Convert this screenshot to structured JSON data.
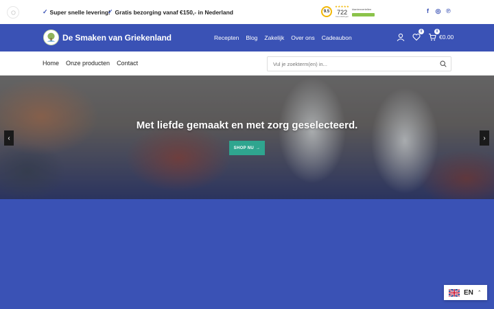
{
  "topbar": {
    "usps": [
      "Super snelle levering!",
      "Gratis bezorging vanaf €150,- in Nederland"
    ],
    "check_icon": "check-icon",
    "rating": {
      "score": "9.5",
      "review_count": "722",
      "reviews_label": "beoordelingen",
      "brand": "klantenvertellen",
      "stars": "★★★★★"
    },
    "social": [
      {
        "icon": "facebook-icon",
        "glyph": "f"
      },
      {
        "icon": "instagram-icon",
        "glyph": "◎"
      },
      {
        "icon": "pinterest-icon",
        "glyph": "℗"
      }
    ]
  },
  "header": {
    "logo_text": "De Smaken van Griekenland",
    "nav": [
      "Recepten",
      "Blog",
      "Zakelijk",
      "Over ons",
      "Cadeaubon"
    ],
    "wishlist_count": "0",
    "cart_count": "0",
    "cart_total": "€0.00"
  },
  "subnav": {
    "items": [
      "Home",
      "Onze producten",
      "Contact"
    ],
    "search_placeholder": "Vul je zoekterm(en) in..."
  },
  "hero": {
    "headline": "Met liefde gemaakt en met zorg geselecteerd.",
    "cta": "SHOP NU"
  },
  "language": {
    "code": "EN"
  },
  "colors": {
    "brand_blue": "#3a52b5",
    "cta_green": "#2fa58f",
    "rating_gold": "#f2b705"
  }
}
